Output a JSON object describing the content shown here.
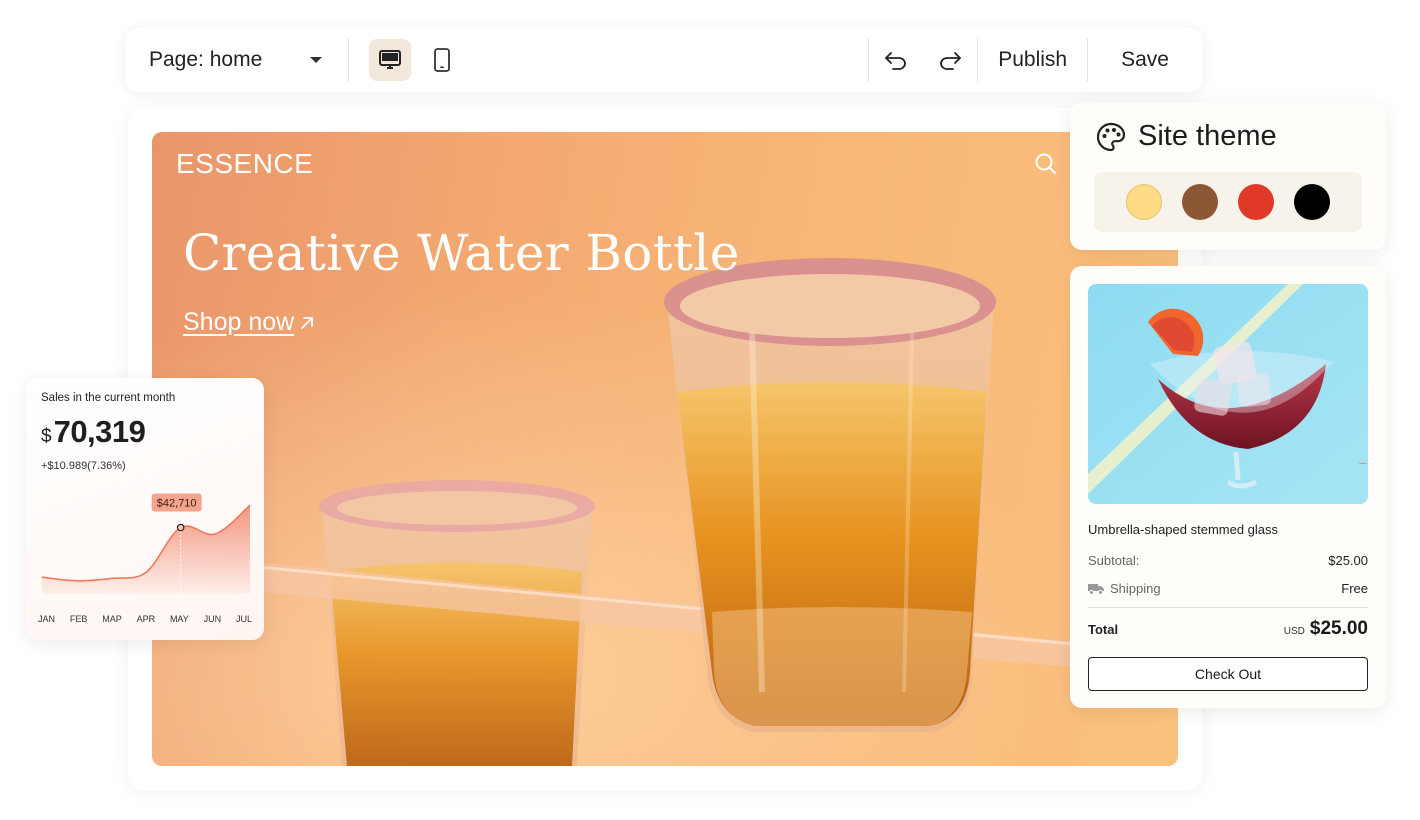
{
  "toolbar": {
    "page_label": "Page: home",
    "publish_label": "Publish",
    "save_label": "Save"
  },
  "hero": {
    "brand": "ESSENCE",
    "title": "Creative Water Bottle",
    "cta": "Shop now"
  },
  "sales": {
    "title": "Sales in the current month",
    "currency": "$",
    "amount": "70,319",
    "change": "+$10.989(7.36%)",
    "tooltip": "$42,710"
  },
  "chart_data": {
    "type": "area",
    "title": "Sales in the current month",
    "categories": [
      "JAN",
      "FEB",
      "MAP",
      "APR",
      "MAY",
      "JUN",
      "JUL"
    ],
    "values": [
      22000,
      20500,
      21500,
      24000,
      42710,
      40000,
      52000
    ],
    "highlight": {
      "category": "MAY",
      "value": 42710,
      "label": "$42,710"
    },
    "grid": false,
    "color": "#f2846a"
  },
  "theme": {
    "title": "Site theme",
    "swatches": [
      "#fddc85",
      "#8d5736",
      "#e03928",
      "#000000"
    ]
  },
  "product": {
    "name": "Umbrella-shaped stemmed glass",
    "subtotal_label": "Subtotal:",
    "subtotal_value": "$25.00",
    "shipping_label": "Shipping",
    "shipping_value": "Free",
    "total_label": "Total",
    "total_currency": "USD",
    "total_value": "$25.00",
    "checkout_label": "Check Out"
  }
}
